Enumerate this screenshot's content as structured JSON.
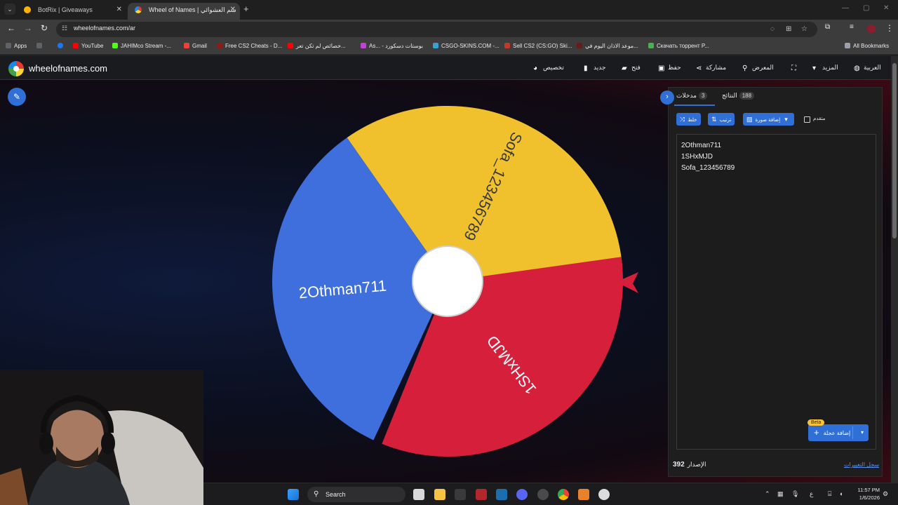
{
  "browser": {
    "tabs": [
      {
        "title": "BotRix | Giveaways",
        "active": false
      },
      {
        "title": "Wheel of Names | سم العشوائي",
        "active": true
      }
    ],
    "url": "wheelofnames.com/ar",
    "bookmarks": [
      {
        "label": "Apps",
        "icon": "apps-grid-icon"
      },
      {
        "label": "YouTube",
        "icon": "youtube-icon"
      },
      {
        "label": "JAHIMco Stream -...",
        "icon": "kick-icon"
      },
      {
        "label": "Gmail",
        "icon": "gmail-icon"
      },
      {
        "label": "Free CS2 Cheats - D...",
        "icon": "site-icon"
      },
      {
        "label": "خصائص لم تكن تعر...",
        "icon": "youtube-icon"
      },
      {
        "label": "As... - بوستات دسكورد",
        "icon": "site-icon"
      },
      {
        "label": "CSGO-SKINS.COM -...",
        "icon": "site-icon"
      },
      {
        "label": "Sell CS2 (CS:GO) Ski...",
        "icon": "site-icon"
      },
      {
        "label": "موعد الاذان اليوم في...",
        "icon": "site-icon"
      },
      {
        "label": "Скачать торрент P...",
        "icon": "site-icon"
      },
      {
        "label": "All Bookmarks",
        "icon": "folder-icon"
      }
    ]
  },
  "site": {
    "name": "wheelofnames.com",
    "menu": [
      {
        "label": "العربية",
        "icon": "globe-icon"
      },
      {
        "label": "المزيد",
        "icon": "caret-down-icon"
      },
      {
        "label": "",
        "icon": "fullscreen-icon"
      },
      {
        "label": "المعرض",
        "icon": "search-icon"
      },
      {
        "label": "مشاركة",
        "icon": "share-icon"
      },
      {
        "label": "حفظ",
        "icon": "save-icon"
      },
      {
        "label": "فتح",
        "icon": "folder-open-icon"
      },
      {
        "label": "جديد",
        "icon": "file-icon"
      },
      {
        "label": "تخصيص",
        "icon": "palette-icon"
      }
    ]
  },
  "wheel": {
    "segments": [
      {
        "label": "Sofa_123456789",
        "color": "#f1c12d"
      },
      {
        "label": "1SHxMJD",
        "color": "#d61f3b"
      },
      {
        "label": "2Othman711",
        "color": "#3f6fdc"
      }
    ],
    "pointer_color": "#d61f3b"
  },
  "panel": {
    "tab_entries": {
      "label": "مدخلات",
      "count": "3"
    },
    "tab_results": {
      "label": "النتائج",
      "count": "188"
    },
    "controls": {
      "shuffle": "خلط",
      "sort": "ترتيب",
      "add_image": "إضافة صورة",
      "advanced": "متقدم"
    },
    "entries": [
      "2Othman711",
      "1SHxMJD",
      "Sofa_123456789"
    ],
    "add_wheel": "إضافة عجلة",
    "beta": "Beta",
    "version_label": "الإصدار",
    "version_number": "392",
    "changelog_link": "سجل التغييرات"
  },
  "taskbar": {
    "search_placeholder": "Search",
    "time": "11:57 PM",
    "date": "1/6/2026",
    "lang": "ع"
  }
}
